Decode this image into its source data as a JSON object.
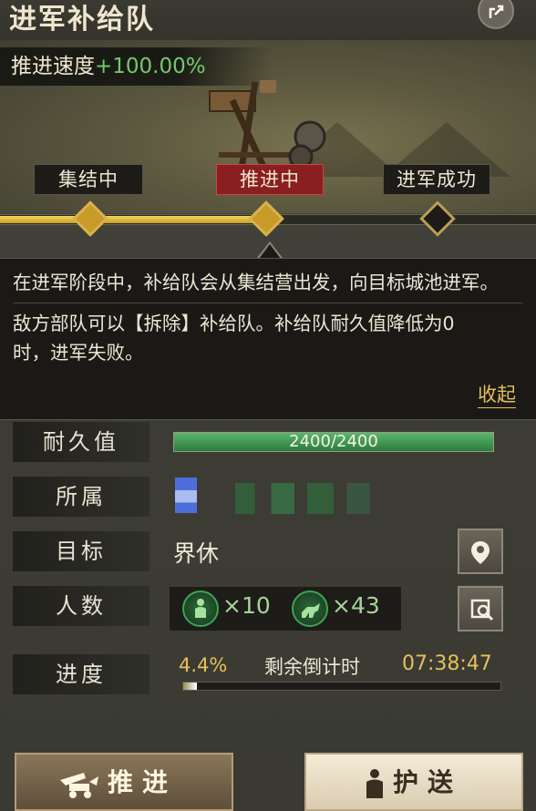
{
  "header": {
    "title": "进军补给队"
  },
  "speed": {
    "label": "推进速度",
    "value": "+100.00%"
  },
  "stages": [
    {
      "label": "集结中",
      "state": "done"
    },
    {
      "label": "推进中",
      "state": "active"
    },
    {
      "label": "进军成功",
      "state": "pending"
    }
  ],
  "stage_progress": 0.5,
  "description": {
    "paragraph1": "在进军阶段中，补给队会从集结营出发，向目标城池进军。",
    "paragraph2": "敌方部队可以【拆除】补给队。补给队耐久值降低为0时，进军失败。",
    "collapse_label": "收起"
  },
  "info": {
    "durability": {
      "label": "耐久值",
      "value": "2400/2400",
      "fraction": 1.0
    },
    "owner": {
      "label": "所属"
    },
    "target": {
      "label": "目标",
      "value": "界休"
    },
    "troops": {
      "label": "人数",
      "infantry": "×10",
      "cavalry": "×43"
    },
    "progress": {
      "label": "进度",
      "percent": "4.4%",
      "fraction": 0.044,
      "countdown_label": "剩余倒计时",
      "countdown_value": "07:38:47"
    }
  },
  "buttons": {
    "advance": "推进",
    "escort": "护送"
  },
  "colors": {
    "accent": "#e6c058",
    "hp": "#3fa352",
    "active_stage": "#8a1f1f"
  },
  "icons": [
    "share-icon",
    "location-pin-icon",
    "search-icon",
    "infantry-icon",
    "cavalry-icon",
    "cart-icon",
    "soldier-icon"
  ]
}
